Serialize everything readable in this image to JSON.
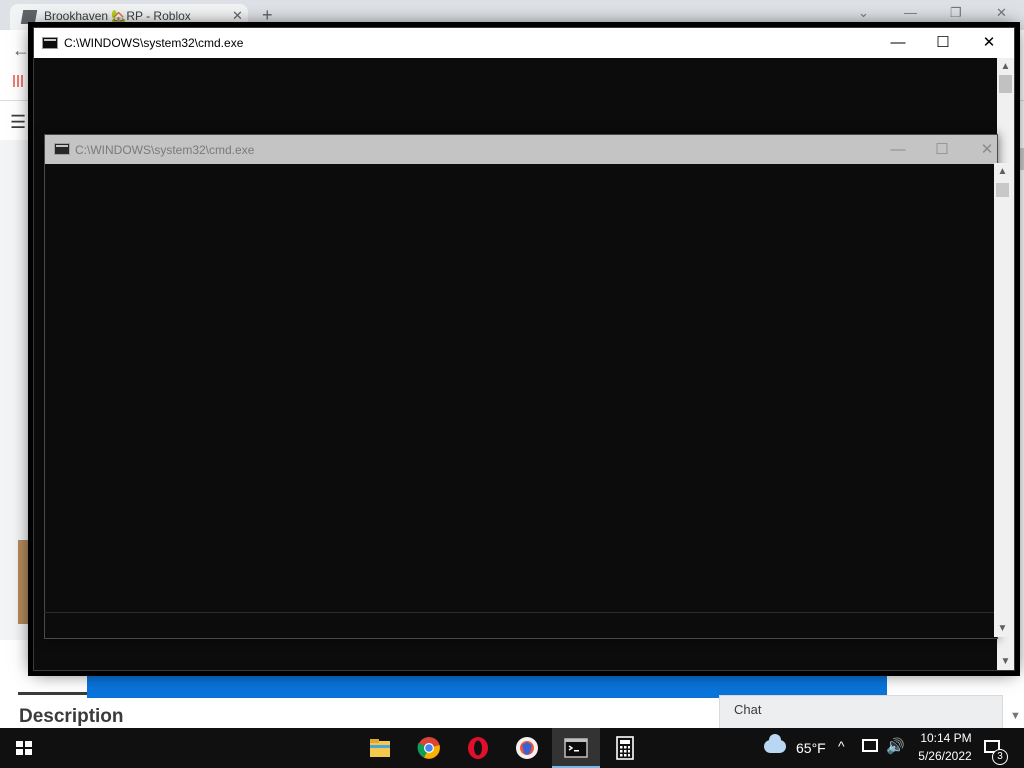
{
  "browser": {
    "tab_title": "Brookhaven 🏡RP - Roblox",
    "tab_close": "✕",
    "new_tab": "+",
    "minimize": "—",
    "restore": "❐",
    "close": "✕"
  },
  "page": {
    "description_heading": "Description",
    "chat_label": "Chat"
  },
  "cmd_window_active": {
    "title": "C:\\WINDOWS\\system32\\cmd.exe",
    "minimize": "—",
    "maximize": "☐",
    "close": "✕"
  },
  "cmd_window_inactive": {
    "title": "C:\\WINDOWS\\system32\\cmd.exe",
    "minimize": "—",
    "maximize": "☐",
    "close": "✕"
  },
  "taskbar": {
    "pinned": [
      "file-explorer-icon",
      "chrome-icon",
      "opera-icon",
      "brave-icon",
      "cmd-icon",
      "calculator-icon"
    ],
    "active_app": "cmd"
  },
  "tray": {
    "weather": "65°F",
    "chevron": "^",
    "volume": "🔊",
    "time": "10:14 PM",
    "date": "5/26/2022",
    "notification_count": "3"
  },
  "colors": {
    "console_bg": "#0c0c0c",
    "taskbar_bg": "#101010",
    "accent_blue": "#0a74da"
  }
}
